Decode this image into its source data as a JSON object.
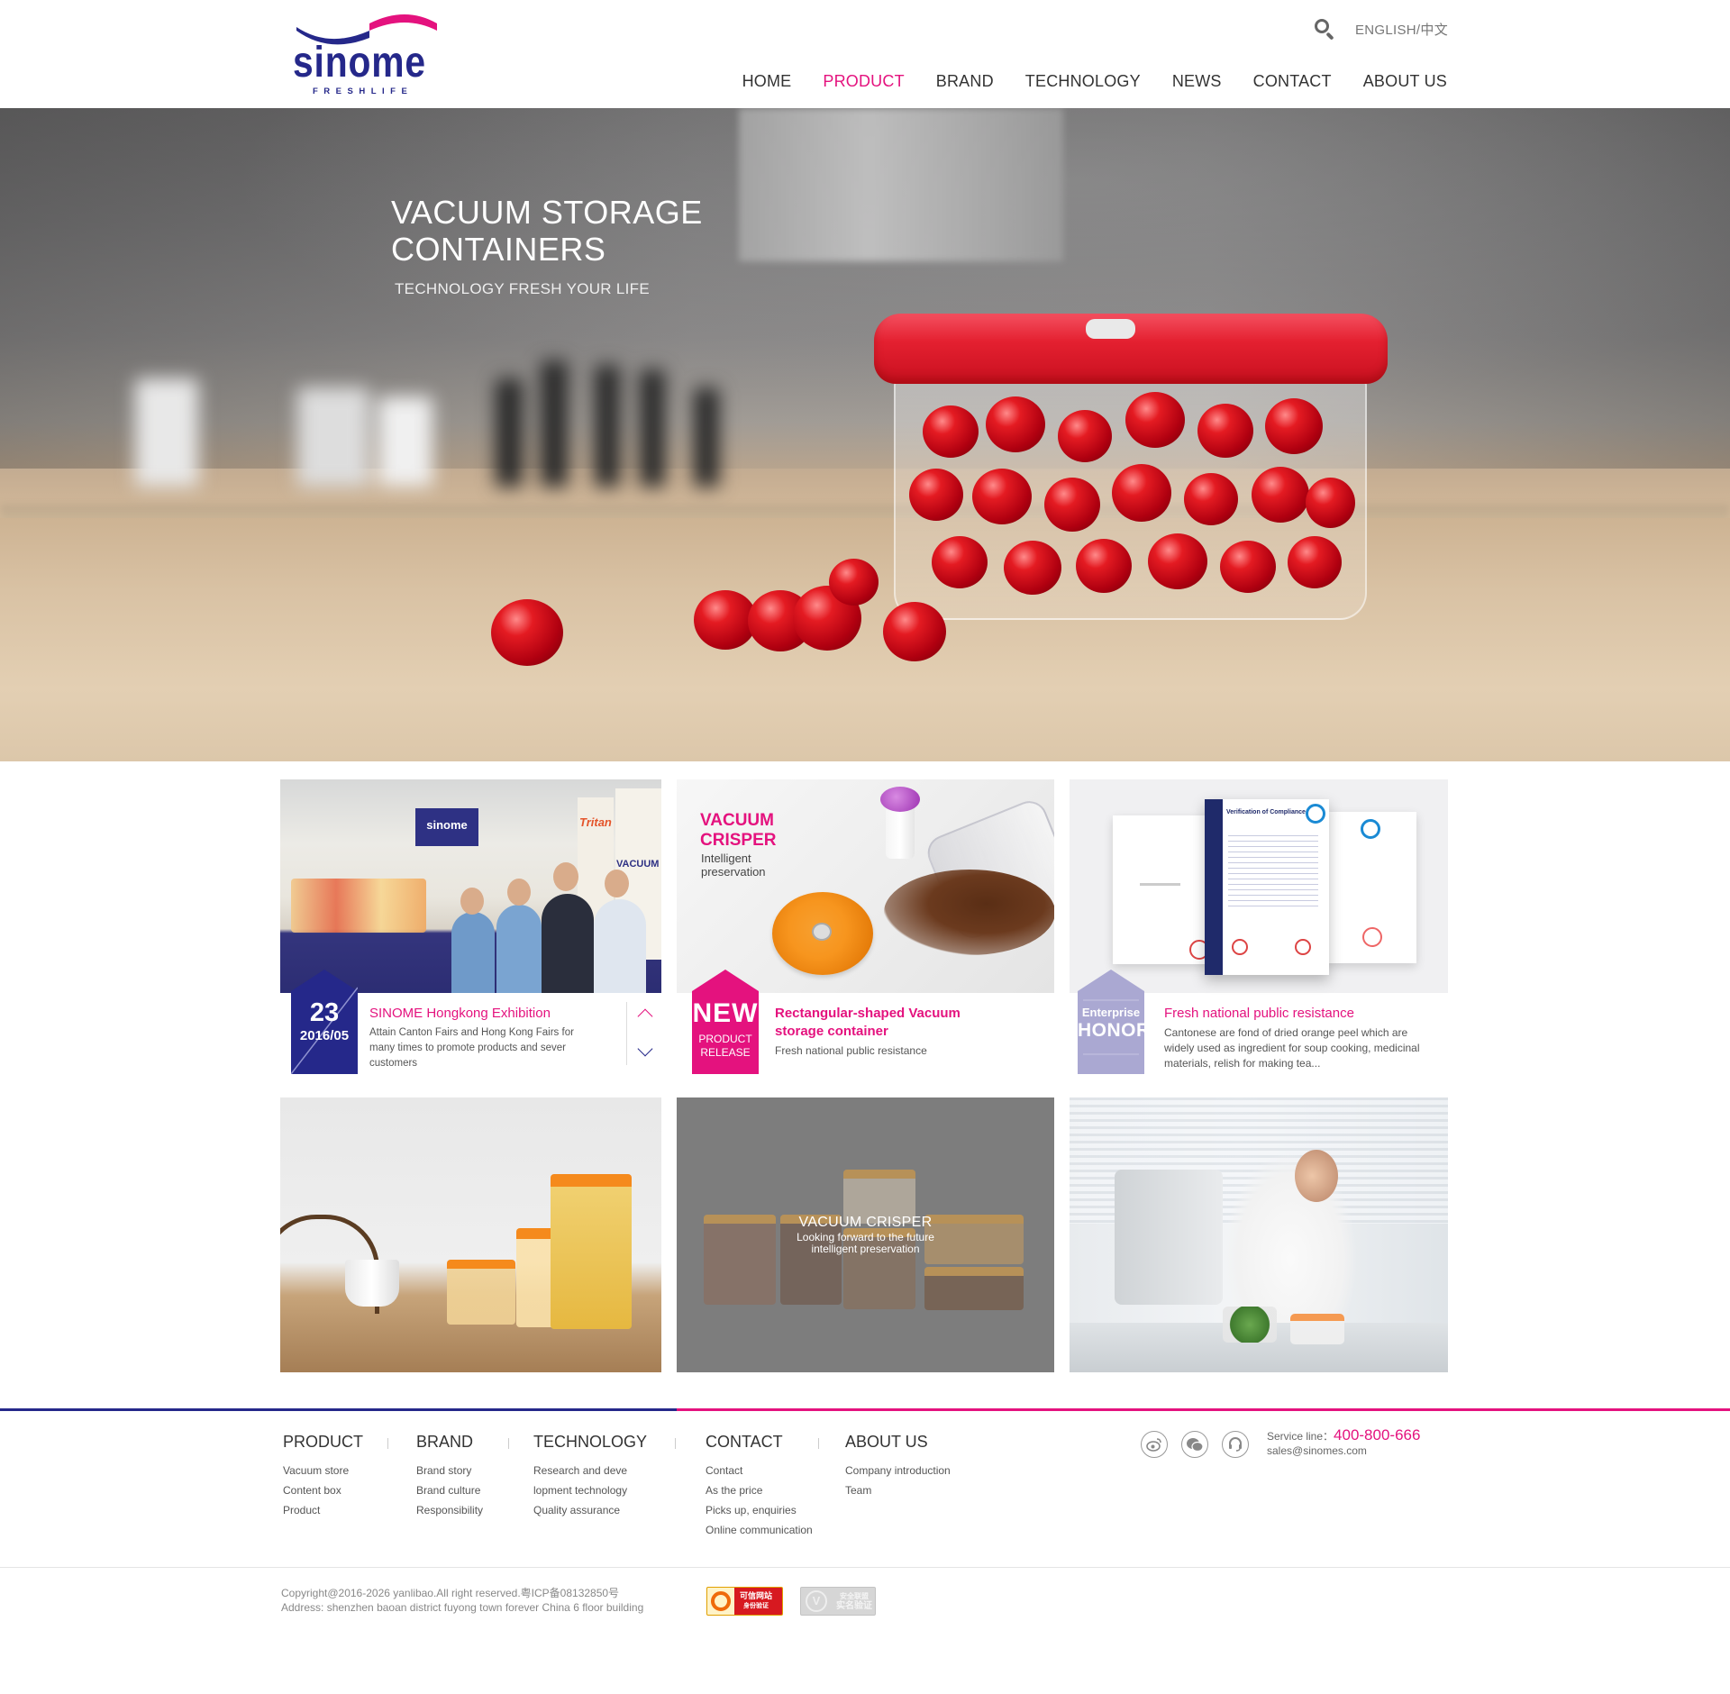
{
  "header": {
    "logo": {
      "brand": "SINOME",
      "tagline": "FRESHLIFE"
    },
    "language": "ENGLISH/中文",
    "search_icon": "search-icon",
    "nav": [
      {
        "label": "HOME",
        "active": false
      },
      {
        "label": "PRODUCT",
        "active": true
      },
      {
        "label": "BRAND",
        "active": false
      },
      {
        "label": "TECHNOLOGY",
        "active": false
      },
      {
        "label": "NEWS",
        "active": false
      },
      {
        "label": "CONTACT",
        "active": false
      },
      {
        "label": "ABOUT US",
        "active": false
      }
    ]
  },
  "hero": {
    "title": "VACUUM STORAGE CONTAINERS",
    "subtitle": "TECHNOLOGY FRESH YOUR LIFE"
  },
  "cards": {
    "news": {
      "day": "23",
      "month": "2016/05",
      "title": "SINOME Hongkong Exhibition",
      "description": "Attain Canton Fairs and Hong Kong Fairs for many times to promote products and sever customers",
      "photo_sign": "sinome",
      "photo_banner_1": "Tritan",
      "photo_banner_2": "VACUUM"
    },
    "new_product": {
      "image_title_1": "VACUUM",
      "image_title_2": "CRISPER",
      "image_sub_1": "Intelligent",
      "image_sub_2": "preservation",
      "badge_main": "NEW",
      "badge_sub_1": "PRODUCT",
      "badge_sub_2": "RELEASE",
      "title": "Rectangular-shaped Vacuum storage container",
      "description": "Fresh national public resistance"
    },
    "honor": {
      "badge_top": "Enterprise",
      "badge_main": "HONOR",
      "cert_center_title": "Verification of Compliance",
      "title": "Fresh national public resistance",
      "description": "Cantonese are fond of dried orange peel which are widely used as ingredient for soup cooking, medicinal materials, relish for making tea..."
    },
    "crisper_overlay": {
      "title": "VACUUM CRISPER",
      "subtitle": "Looking forward to the future intelligent preservation"
    }
  },
  "footer": {
    "columns": [
      {
        "title": "PRODUCT",
        "links": [
          "Vacuum store",
          "Content box",
          "Product"
        ]
      },
      {
        "title": "BRAND",
        "links": [
          "Brand story",
          "Brand culture",
          "Responsibility"
        ]
      },
      {
        "title": "TECHNOLOGY",
        "links": [
          "Research and deve",
          "lopment technology",
          "Quality assurance"
        ]
      },
      {
        "title": "CONTACT",
        "links": [
          "Contact",
          "As the price",
          "Picks up, enquiries",
          "Online communication"
        ]
      },
      {
        "title": "ABOUT US",
        "links": [
          "Company introduction",
          "Team"
        ]
      }
    ],
    "social": [
      "weibo-icon",
      "wechat-icon",
      "headset-icon"
    ],
    "service_label": "Service line：",
    "service_phone": "400-800-666",
    "email": "sales@sinomes.com",
    "copyright": "Copyright@2016-2026 yanlibao.All right reserved.粤ICP备08132850号",
    "address": "Address: shenzhen baoan district fuyong town forever China 6 floor building",
    "cert_1_line_1": "可信网站",
    "cert_1_line_2": "身份验证",
    "cert_2_line_1": "安全联盟",
    "cert_2_line_2": "实名验证"
  },
  "colors": {
    "brand_navy": "#25288a",
    "brand_magenta": "#e4127e",
    "honor_lavender": "#aaa8d2"
  }
}
